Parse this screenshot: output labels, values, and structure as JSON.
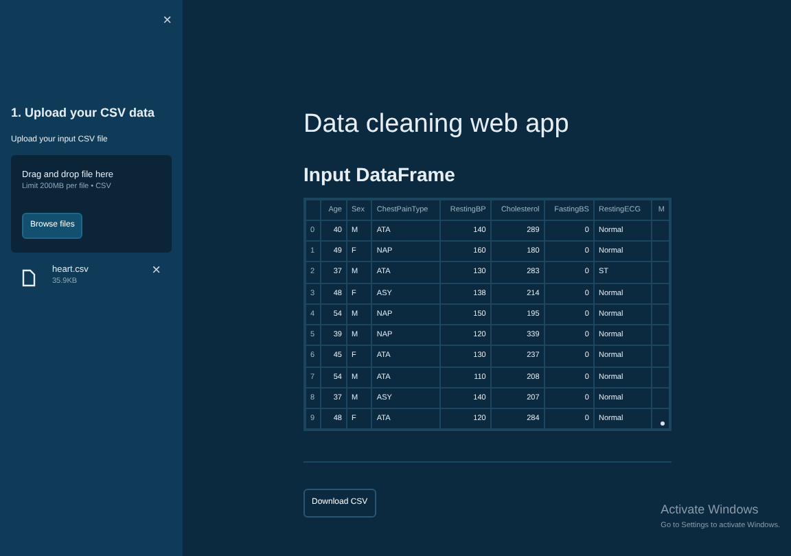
{
  "sidebar": {
    "close": "×",
    "heading": "1. Upload your CSV data",
    "uploader_label": "Upload your input CSV file",
    "dropzone": {
      "title": "Drag and drop file here",
      "hint": "Limit 200MB per file • CSV",
      "button": "Browse files"
    },
    "file": {
      "name": "heart.csv",
      "size": "35.9KB",
      "remove": "×"
    }
  },
  "main": {
    "title": "Data cleaning web app",
    "section": "Input DataFrame",
    "table": {
      "columns": [
        "",
        "Age",
        "Sex",
        "ChestPainType",
        "RestingBP",
        "Cholesterol",
        "FastingBS",
        "RestingECG",
        "M"
      ],
      "rows": [
        [
          "0",
          "40",
          "M",
          "ATA",
          "140",
          "289",
          "0",
          "Normal"
        ],
        [
          "1",
          "49",
          "F",
          "NAP",
          "160",
          "180",
          "0",
          "Normal"
        ],
        [
          "2",
          "37",
          "M",
          "ATA",
          "130",
          "283",
          "0",
          "ST"
        ],
        [
          "3",
          "48",
          "F",
          "ASY",
          "138",
          "214",
          "0",
          "Normal"
        ],
        [
          "4",
          "54",
          "M",
          "NAP",
          "150",
          "195",
          "0",
          "Normal"
        ],
        [
          "5",
          "39",
          "M",
          "NAP",
          "120",
          "339",
          "0",
          "Normal"
        ],
        [
          "6",
          "45",
          "F",
          "ATA",
          "130",
          "237",
          "0",
          "Normal"
        ],
        [
          "7",
          "54",
          "M",
          "ATA",
          "110",
          "208",
          "0",
          "Normal"
        ],
        [
          "8",
          "37",
          "M",
          "ASY",
          "140",
          "207",
          "0",
          "Normal"
        ],
        [
          "9",
          "48",
          "F",
          "ATA",
          "120",
          "284",
          "0",
          "Normal"
        ]
      ]
    },
    "download_button": "Download CSV"
  },
  "os_notice": {
    "title": "Activate Windows",
    "subtitle": "Go to Settings to activate Windows."
  }
}
